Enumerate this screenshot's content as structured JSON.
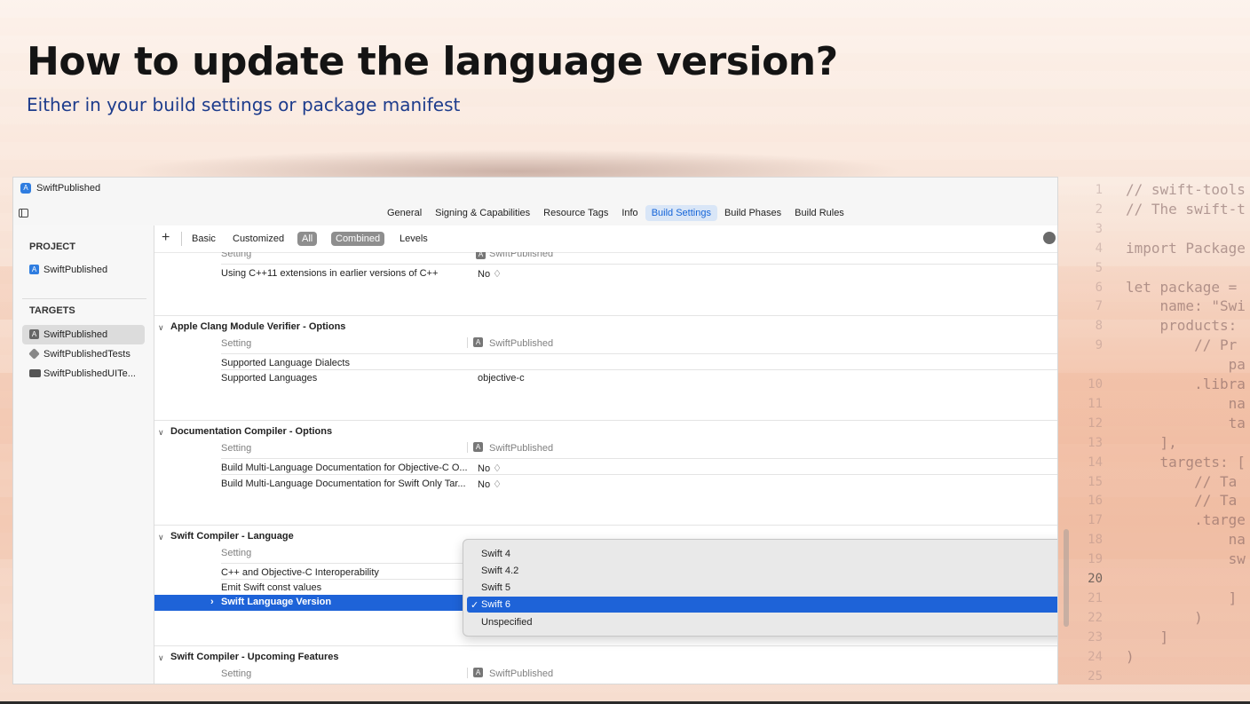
{
  "slide": {
    "title": "How to update the language version?",
    "subtitle": "Either in your build settings or package manifest"
  },
  "window": {
    "title": "SwiftPublished"
  },
  "tabs": [
    {
      "label": "General"
    },
    {
      "label": "Signing & Capabilities"
    },
    {
      "label": "Resource Tags"
    },
    {
      "label": "Info"
    },
    {
      "label": "Build Settings",
      "active": true
    },
    {
      "label": "Build Phases"
    },
    {
      "label": "Build Rules"
    }
  ],
  "navigator": {
    "project_heading": "PROJECT",
    "project_item": "SwiftPublished",
    "targets_heading": "TARGETS",
    "targets": [
      "SwiftPublished",
      "SwiftPublishedTests",
      "SwiftPublishedUITe..."
    ]
  },
  "filter": {
    "plus": "+",
    "basic": "Basic",
    "customized": "Customized",
    "all": "All",
    "combined": "Combined",
    "levels": "Levels"
  },
  "settings": {
    "col_setting": "Setting",
    "target_name": "SwiftPublished",
    "row_cpp11": "Using C++11 extensions in earlier versions of C++",
    "val_no": "No ♢",
    "sec_clang": "Apple Clang Module Verifier - Options",
    "row_dialects": "Supported Language Dialects",
    "row_languages": "Supported Languages",
    "val_objc": "objective-c",
    "sec_doc": "Documentation Compiler - Options",
    "row_doc_objc": "Build Multi-Language Documentation for Objective-C O...",
    "row_doc_swift": "Build Multi-Language Documentation for Swift Only Tar...",
    "sec_swift_lang": "Swift Compiler - Language",
    "row_interop": "C++ and Objective-C Interoperability",
    "row_const": "Emit Swift const values",
    "row_version": "Swift Language Version",
    "sec_upcoming": "Swift Compiler - Upcoming Features"
  },
  "version_menu": {
    "options": [
      "Swift 4",
      "Swift 4.2",
      "Swift 5",
      "Swift 6",
      "Unspecified"
    ],
    "selected": "Swift 6",
    "check": "✓"
  },
  "code": {
    "lines": [
      {
        "n": "1",
        "text": "// swift-tools"
      },
      {
        "n": "2",
        "text": "// The swift-t"
      },
      {
        "n": "3",
        "text": ""
      },
      {
        "n": "4",
        "text": "import Package"
      },
      {
        "n": "5",
        "text": ""
      },
      {
        "n": "6",
        "text": "let package ="
      },
      {
        "n": "7",
        "text": "    name: \"Swi"
      },
      {
        "n": "8",
        "text": "    products:"
      },
      {
        "n": "9",
        "text": "        // Pr"
      },
      {
        "n": "",
        "text": "            pa"
      },
      {
        "n": "10",
        "text": "        .libra"
      },
      {
        "n": "11",
        "text": "            na"
      },
      {
        "n": "12",
        "text": "            ta"
      },
      {
        "n": "13",
        "text": "    ],"
      },
      {
        "n": "14",
        "text": "    targets: ["
      },
      {
        "n": "15",
        "text": "        // Ta"
      },
      {
        "n": "16",
        "text": "        // Ta"
      },
      {
        "n": "17",
        "text": "        .targe"
      },
      {
        "n": "18",
        "text": "            na"
      },
      {
        "n": "19",
        "text": "            sw"
      },
      {
        "n": "20",
        "text": ""
      },
      {
        "n": "21",
        "text": "            ]"
      },
      {
        "n": "22",
        "text": "        )"
      },
      {
        "n": "23",
        "text": "    ]"
      },
      {
        "n": "24",
        "text": ")"
      },
      {
        "n": "25",
        "text": ""
      }
    ]
  }
}
